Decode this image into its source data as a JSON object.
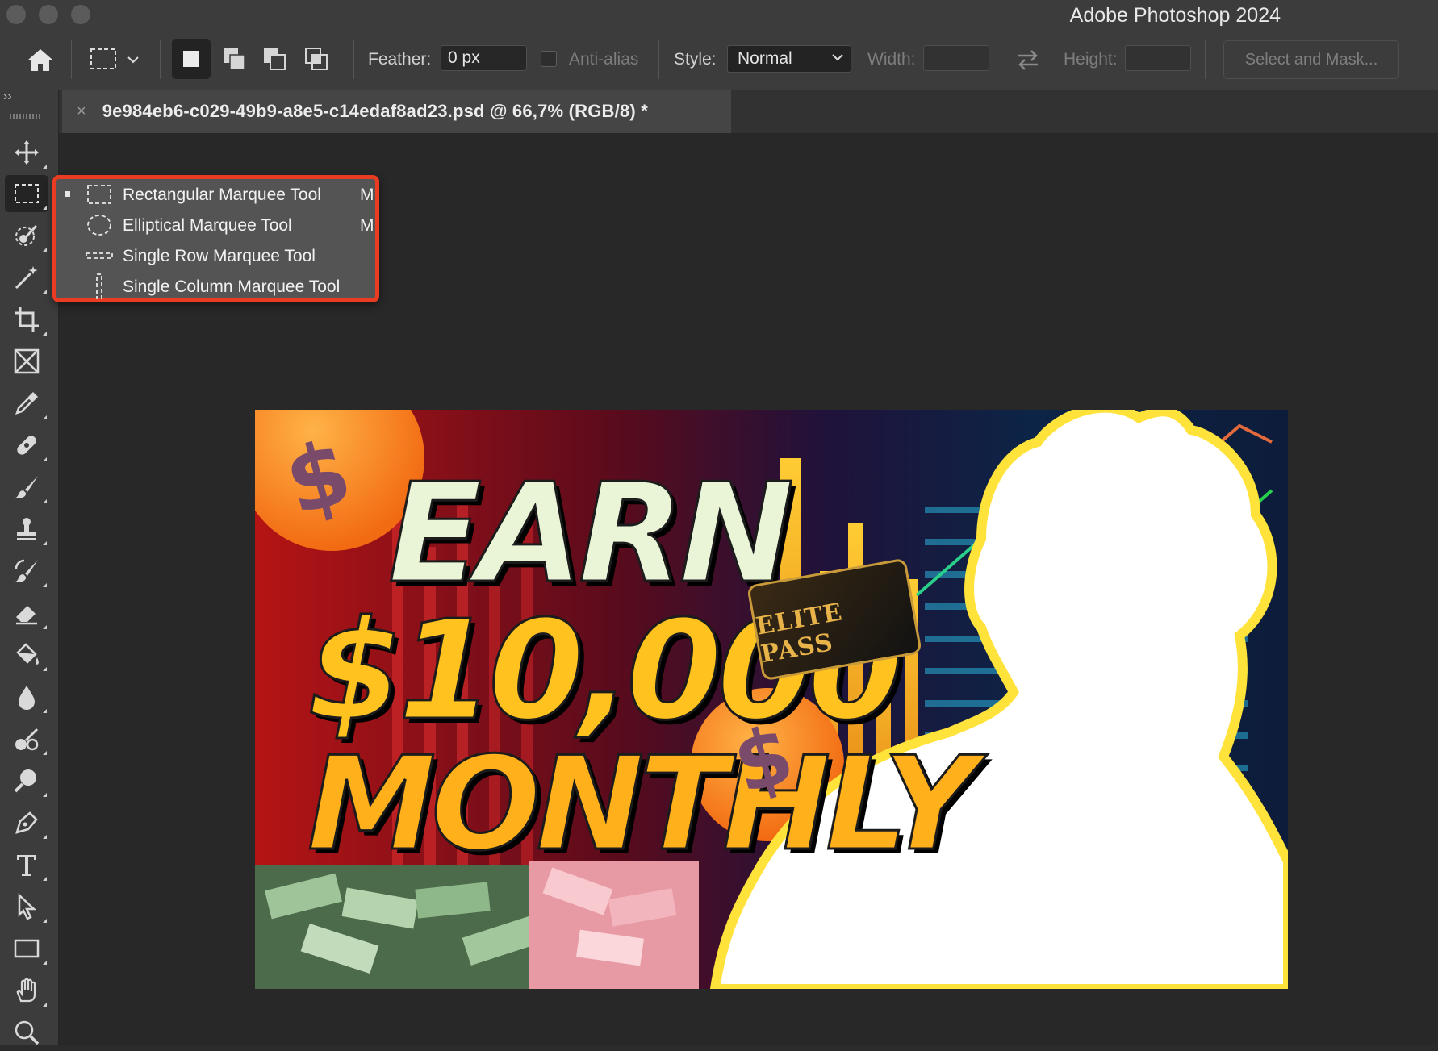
{
  "window": {
    "title": "Adobe Photoshop 2024"
  },
  "icons": {
    "home": "home-icon",
    "marquee": "rectangular-marquee-icon",
    "swap": "swap-arrows-icon"
  },
  "options_bar": {
    "feather_label": "Feather:",
    "feather_value": "0 px",
    "antialias_label": "Anti-alias",
    "style_label": "Style:",
    "style_value": "Normal",
    "width_label": "Width:",
    "height_label": "Height:",
    "select_mask_label": "Select and Mask..."
  },
  "document": {
    "tab_title": "9e984eb6-c029-49b9-a8e5-c14edaf8ad23.psd @ 66,7% (RGB/8) *",
    "close_glyph": "×"
  },
  "artwork": {
    "line1": "EARN",
    "line2": "$10,000",
    "line3": "MONTHLY",
    "badge_text": "ELITE PASS",
    "coin_symbol": "$"
  },
  "flyout": {
    "items": [
      {
        "label": "Rectangular Marquee Tool",
        "shortcut": "M",
        "icon": "rect-marquee-icon",
        "active": true
      },
      {
        "label": "Elliptical Marquee Tool",
        "shortcut": "M",
        "icon": "ellipse-marquee-icon",
        "active": false
      },
      {
        "label": "Single Row Marquee Tool",
        "shortcut": "",
        "icon": "single-row-icon",
        "active": false
      },
      {
        "label": "Single Column Marquee Tool",
        "shortcut": "",
        "icon": "single-column-icon",
        "active": false
      }
    ]
  },
  "colors": {
    "highlight_border": "#ea3b23",
    "chrome": "#3c3c3c",
    "canvas": "#282828"
  }
}
